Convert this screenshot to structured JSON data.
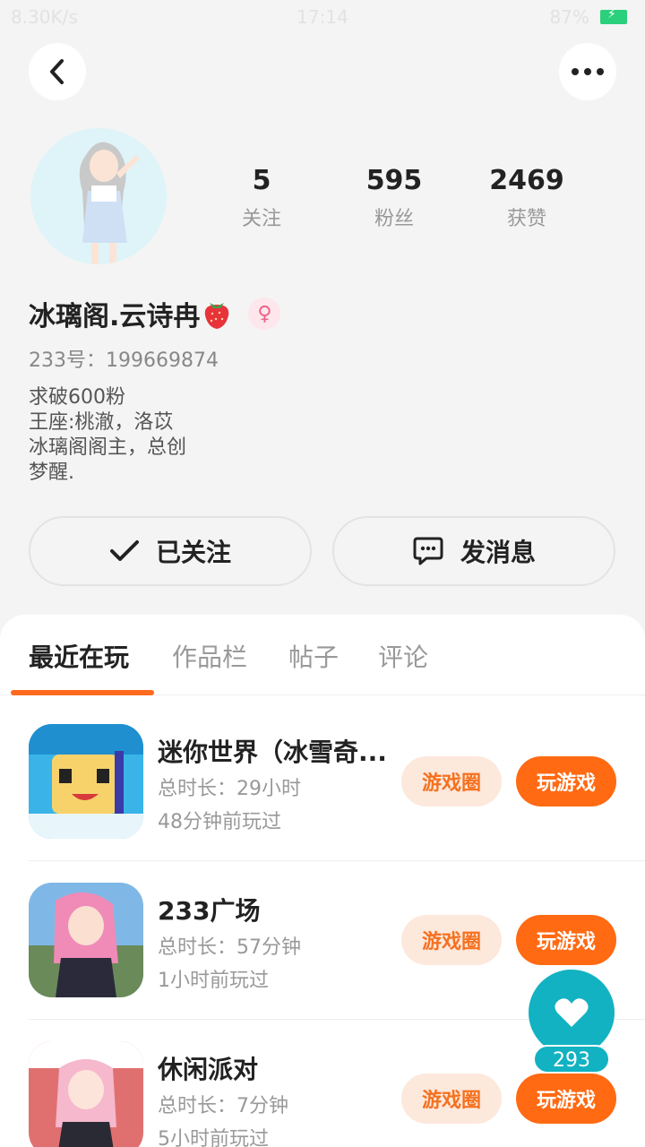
{
  "status_bar": {
    "net_speed": "8.30K/s",
    "time": "17:14",
    "battery": "87%"
  },
  "profile": {
    "name": "冰璃阁.云诗冉",
    "uid": "233号：199669874",
    "bio": [
      "求破600粉",
      "王座:桃澈，洛苡",
      "冰璃阁阁主，总创",
      "梦醒."
    ],
    "stats": [
      {
        "value": "5",
        "label": "关注"
      },
      {
        "value": "595",
        "label": "粉丝"
      },
      {
        "value": "2469",
        "label": "获赞"
      }
    ],
    "follow_label": "已关注",
    "message_label": "发消息"
  },
  "tabs": [
    "最近在玩",
    "作品栏",
    "帖子",
    "评论"
  ],
  "games": [
    {
      "title": "迷你世界（冰雪奇...",
      "duration": "总时长：29小时",
      "last_played": "48分钟前玩过",
      "circle_label": "游戏圈",
      "play_label": "玩游戏"
    },
    {
      "title": "233广场",
      "duration": "总时长：57分钟",
      "last_played": "1小时前玩过",
      "circle_label": "游戏圈",
      "play_label": "玩游戏"
    },
    {
      "title": "休闲派对",
      "duration": "总时长：7分钟",
      "last_played": "5小时前玩过",
      "circle_label": "游戏圈",
      "play_label": "玩游戏"
    }
  ],
  "like_fab": {
    "count": "293"
  },
  "colors": {
    "accent": "#ff6a13",
    "fab": "#12b2c2"
  }
}
